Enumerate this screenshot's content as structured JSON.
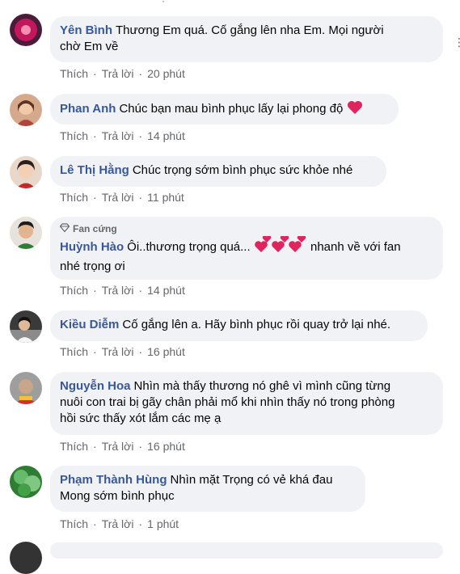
{
  "colors": {
    "author": "#385898",
    "bubble": "#f0f2f5",
    "meta": "#65676b",
    "heart": "#e0245e"
  },
  "actions": {
    "like": "Thích",
    "reply": "Trả lời",
    "dot": "·"
  },
  "comments": [
    {
      "author": "Yên Bình",
      "text1": "Thương Em quá. Cố gắng lên nha Em. Mọi người",
      "text2": "chờ Em về",
      "time": "20 phút"
    },
    {
      "author": "Phan Anh",
      "text": "Chúc bạn mau bình phục lấy lại phong độ",
      "emoji": "heart",
      "time": "14 phút"
    },
    {
      "author": "Lê Thị Hằng",
      "text": "Chúc trọng sớm bình phục sức khỏe nhé",
      "time": "11 phút"
    },
    {
      "badge": "Fan cứng",
      "author": "Huỳnh Hào",
      "text_a": "Ôi..thương trọng quá...",
      "text_b": "nhanh về với fan",
      "text2": "nhé trọng ơi",
      "emoji": "hearts",
      "time": "14 phút"
    },
    {
      "author": "Kiều Diễm",
      "text": "Cố gắng lên a. Hãy bình phục rồi quay trở lại nhé.",
      "time": "16 phút"
    },
    {
      "author": "Nguyễn Hoa",
      "text1": "Nhìn mà thấy thương nó ghê vì mình cũng từng",
      "text2": "nuôi con trai bị gãy chân phải mổ khi nhìn thấy nó trong phòng",
      "text3": "hồi sức thấy xót lắm các mẹ ạ",
      "time": "16 phút"
    },
    {
      "author": "Phạm Thành Hùng",
      "text1": "Nhìn mặt Trọng có vẻ khá đau",
      "text2": "Mong sớm bình phục",
      "time": "1 phút"
    }
  ]
}
